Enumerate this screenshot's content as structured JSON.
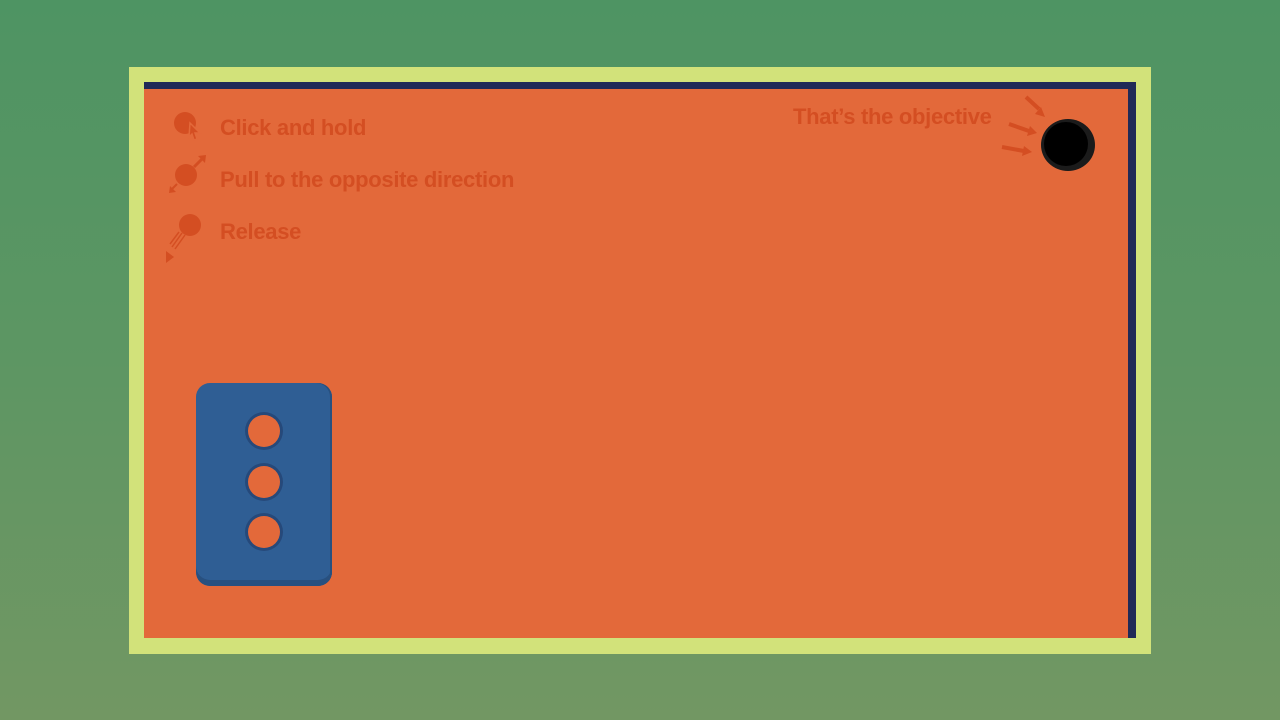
{
  "instructions": [
    {
      "label": "Click and hold",
      "icon": "click-hold-icon"
    },
    {
      "label": "Pull to the opposite direction",
      "icon": "pull-icon"
    },
    {
      "label": "Release",
      "icon": "release-icon"
    }
  ],
  "objective": {
    "label": "That’s the objective",
    "icon": "target-hole-icon"
  },
  "balls_remaining": 3,
  "colors": {
    "background_top": "#4e9463",
    "frame": "#d2e27a",
    "wall": "#1f2a57",
    "field": "#e3693a",
    "instruction_text": "#d44e22",
    "tray": "#2f5e94",
    "hole": "#000000"
  }
}
